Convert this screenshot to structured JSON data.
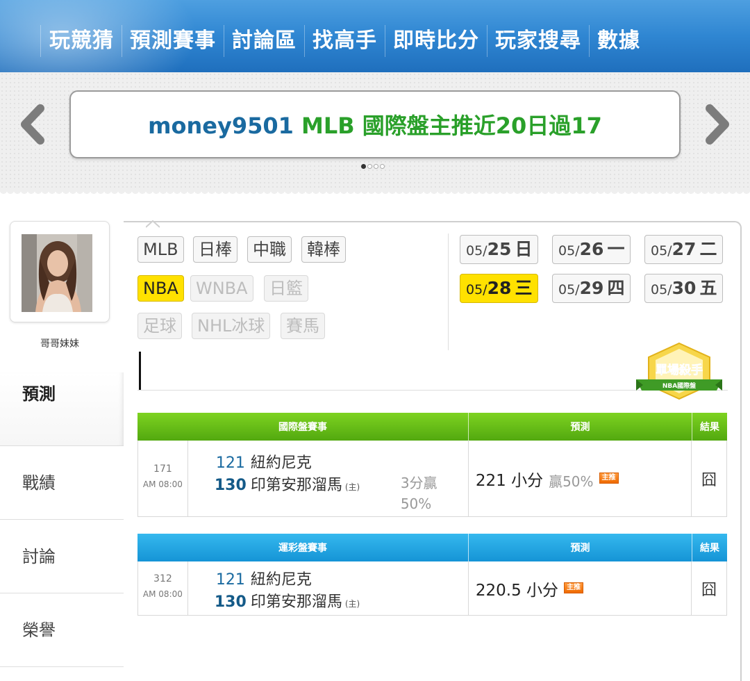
{
  "nav": {
    "items": [
      "玩競猜",
      "預測賽事",
      "討論區",
      "找高手",
      "即時比分",
      "玩家搜尋",
      "數據"
    ]
  },
  "banner": {
    "user": "money9501",
    "message": " MLB 國際盤主推近20日過17",
    "page_count": 4,
    "active_page": 1
  },
  "profile": {
    "name": "哥哥妹妹"
  },
  "sidebar": {
    "tabs": [
      {
        "label": "預測",
        "active": true
      },
      {
        "label": "戰績",
        "active": false
      },
      {
        "label": "討論",
        "active": false
      },
      {
        "label": "榮譽",
        "active": false
      }
    ]
  },
  "categories": {
    "row1": [
      {
        "label": "MLB",
        "state": "normal"
      },
      {
        "label": "日棒",
        "state": "normal"
      },
      {
        "label": "中職",
        "state": "normal"
      },
      {
        "label": "韓棒",
        "state": "normal"
      }
    ],
    "row2": [
      {
        "label": "NBA",
        "state": "active"
      },
      {
        "label": "WNBA",
        "state": "disabled"
      },
      {
        "label": "日籃",
        "state": "disabled"
      }
    ],
    "row3": [
      {
        "label": "足球",
        "state": "disabled"
      },
      {
        "label": "NHL冰球",
        "state": "disabled"
      },
      {
        "label": "賽馬",
        "state": "disabled"
      }
    ]
  },
  "dates": [
    {
      "month": "05/",
      "day": "25",
      "weekday": "日",
      "active": false
    },
    {
      "month": "05/",
      "day": "26",
      "weekday": "一",
      "active": false
    },
    {
      "month": "05/",
      "day": "27",
      "weekday": "二",
      "active": false
    },
    {
      "month": "05/",
      "day": "28",
      "weekday": "三",
      "active": true
    },
    {
      "month": "05/",
      "day": "29",
      "weekday": "四",
      "active": false
    },
    {
      "month": "05/",
      "day": "30",
      "weekday": "五",
      "active": false
    }
  ],
  "badge": {
    "title": "單場殺手",
    "subtitle": "NBA國際盤"
  },
  "intl_table": {
    "headers": {
      "game": "國際盤賽事",
      "prediction": "預測",
      "result": "結果"
    },
    "row": {
      "game_no": "171",
      "time": "AM 08:00",
      "away_no": "121",
      "away": "紐約尼克",
      "home_no": "130",
      "home": "印第安那溜馬",
      "home_tag": "(主)",
      "spread_line1": "3分贏",
      "spread_line2": "50%",
      "prediction": "221 小分",
      "prediction_sub": "贏50%",
      "tag": "主推",
      "result": "囧"
    }
  },
  "sports_table": {
    "headers": {
      "game": "運彩盤賽事",
      "prediction": "預測",
      "result": "結果"
    },
    "row": {
      "game_no": "312",
      "time": "AM 08:00",
      "away_no": "121",
      "away": "紐約尼克",
      "home_no": "130",
      "home": "印第安那溜馬",
      "home_tag": "(主)",
      "prediction": "220.5 小分",
      "tag": "主推",
      "result": "囧"
    }
  },
  "colors": {
    "nav_blue": "#2f86d2",
    "active_yellow": "#ffe100",
    "header_green": "#5cb318",
    "header_blue": "#1ea4e2",
    "tag_orange": "#ef6a00"
  }
}
